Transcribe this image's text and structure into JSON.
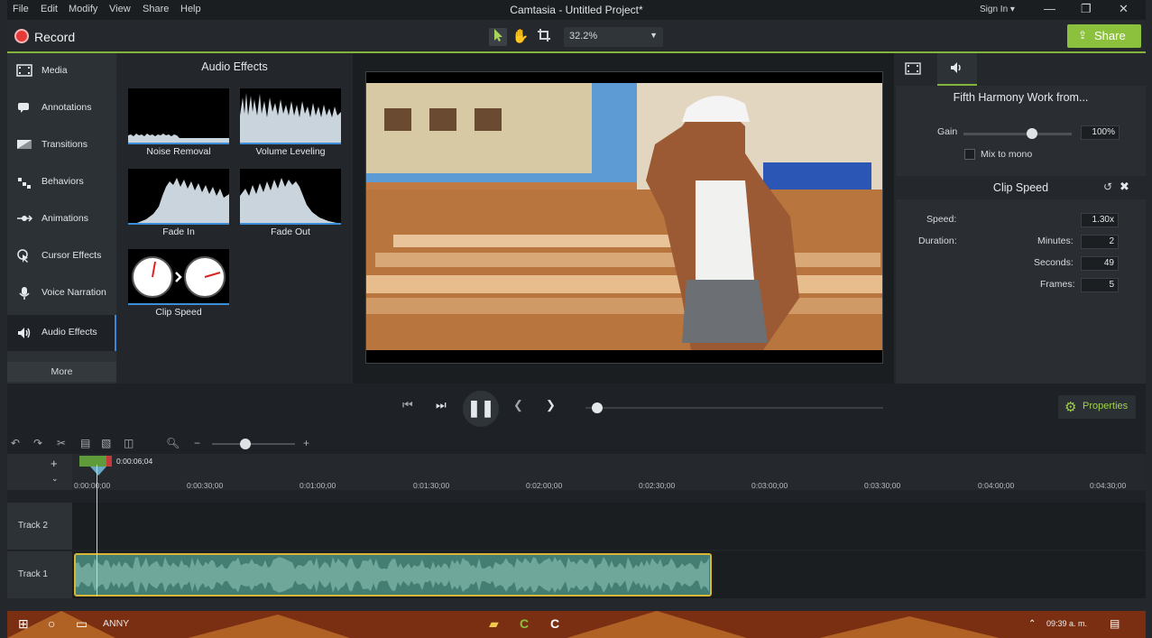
{
  "menu": {
    "file": "File",
    "edit": "Edit",
    "modify": "Modify",
    "view": "View",
    "share": "Share",
    "help": "Help"
  },
  "window_title": "Camtasia - Untitled Project*",
  "sign_in": "Sign In ▾",
  "toolbar": {
    "record_label": "Record",
    "zoom_value": "32.2%",
    "share_label": "Share"
  },
  "sidebar": {
    "items": [
      {
        "label": "Media",
        "icon": "film-icon"
      },
      {
        "label": "Annotations",
        "icon": "annotation-icon"
      },
      {
        "label": "Transitions",
        "icon": "transition-icon"
      },
      {
        "label": "Behaviors",
        "icon": "behaviors-icon"
      },
      {
        "label": "Animations",
        "icon": "animation-icon"
      },
      {
        "label": "Cursor Effects",
        "icon": "cursor-icon"
      },
      {
        "label": "Voice Narration",
        "icon": "microphone-icon"
      },
      {
        "label": "Audio Effects",
        "icon": "speaker-icon"
      }
    ],
    "more_label": "More"
  },
  "effects_panel": {
    "title": "Audio Effects",
    "items": [
      {
        "label": "Noise Removal"
      },
      {
        "label": "Volume Leveling"
      },
      {
        "label": "Fade In"
      },
      {
        "label": "Fade Out"
      },
      {
        "label": "Clip Speed"
      }
    ]
  },
  "properties": {
    "media_title": "Fifth Harmony   Work from...",
    "gain_label": "Gain",
    "gain_value": "100%",
    "mix_label": "Mix to mono",
    "clip_speed_title": "Clip Speed",
    "speed_label": "Speed:",
    "speed_value": "1.30x",
    "duration_label": "Duration:",
    "minutes_label": "Minutes:",
    "minutes_value": "2",
    "seconds_label": "Seconds:",
    "seconds_value": "49",
    "frames_label": "Frames:",
    "frames_value": "5"
  },
  "transport": {
    "properties_label": "Properties"
  },
  "timeline": {
    "playhead_time": "0:00:06;04",
    "ticks": [
      "0:00:00;00",
      "0:00:30;00",
      "0:01:00;00",
      "0:01:30;00",
      "0:02:00;00",
      "0:02:30;00",
      "0:03:00;00",
      "0:03:30;00",
      "0:04:00;00",
      "0:04:30;00"
    ],
    "tracks": [
      {
        "name": "Track 2"
      },
      {
        "name": "Track 1"
      }
    ]
  },
  "taskbar": {
    "label": "ANNY",
    "clock": "09:39 a. m."
  },
  "colors": {
    "accent_green": "#83b53a",
    "record_red": "#e63a3a",
    "selection_blue": "#3a87d6",
    "clip_teal": "#447d72",
    "clip_border": "#d8b638"
  }
}
